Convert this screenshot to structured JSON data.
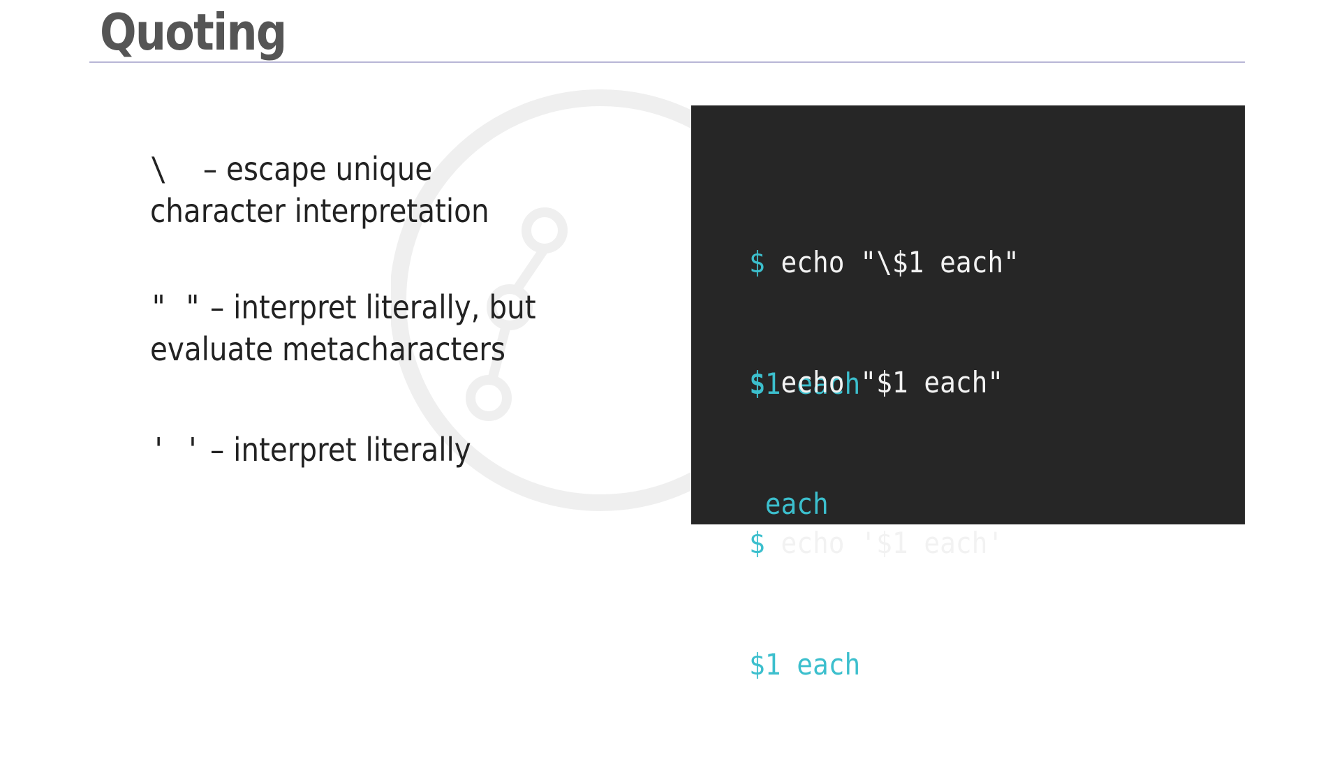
{
  "slide": {
    "title": "Quoting",
    "items": [
      {
        "symbol": "\\",
        "line1": "– escape unique",
        "line2": "character interpretation"
      },
      {
        "symbol": "\"  \"",
        "line1": "– interpret literally, but",
        "line2": "evaluate metacharacters"
      },
      {
        "symbol": "'   '",
        "line1": "–  interpret literally"
      }
    ]
  },
  "terminal": {
    "prompt": "$",
    "blocks": [
      {
        "command": "echo \"\\$1 each\"",
        "output": "$1 each"
      },
      {
        "command": "echo \"$1 each\"",
        "output": " each"
      },
      {
        "command": "echo '$1 each'",
        "output": "$1 each"
      }
    ]
  },
  "colors": {
    "accent": "#3cbfcd",
    "panel": "#262626",
    "title": "#555555"
  }
}
